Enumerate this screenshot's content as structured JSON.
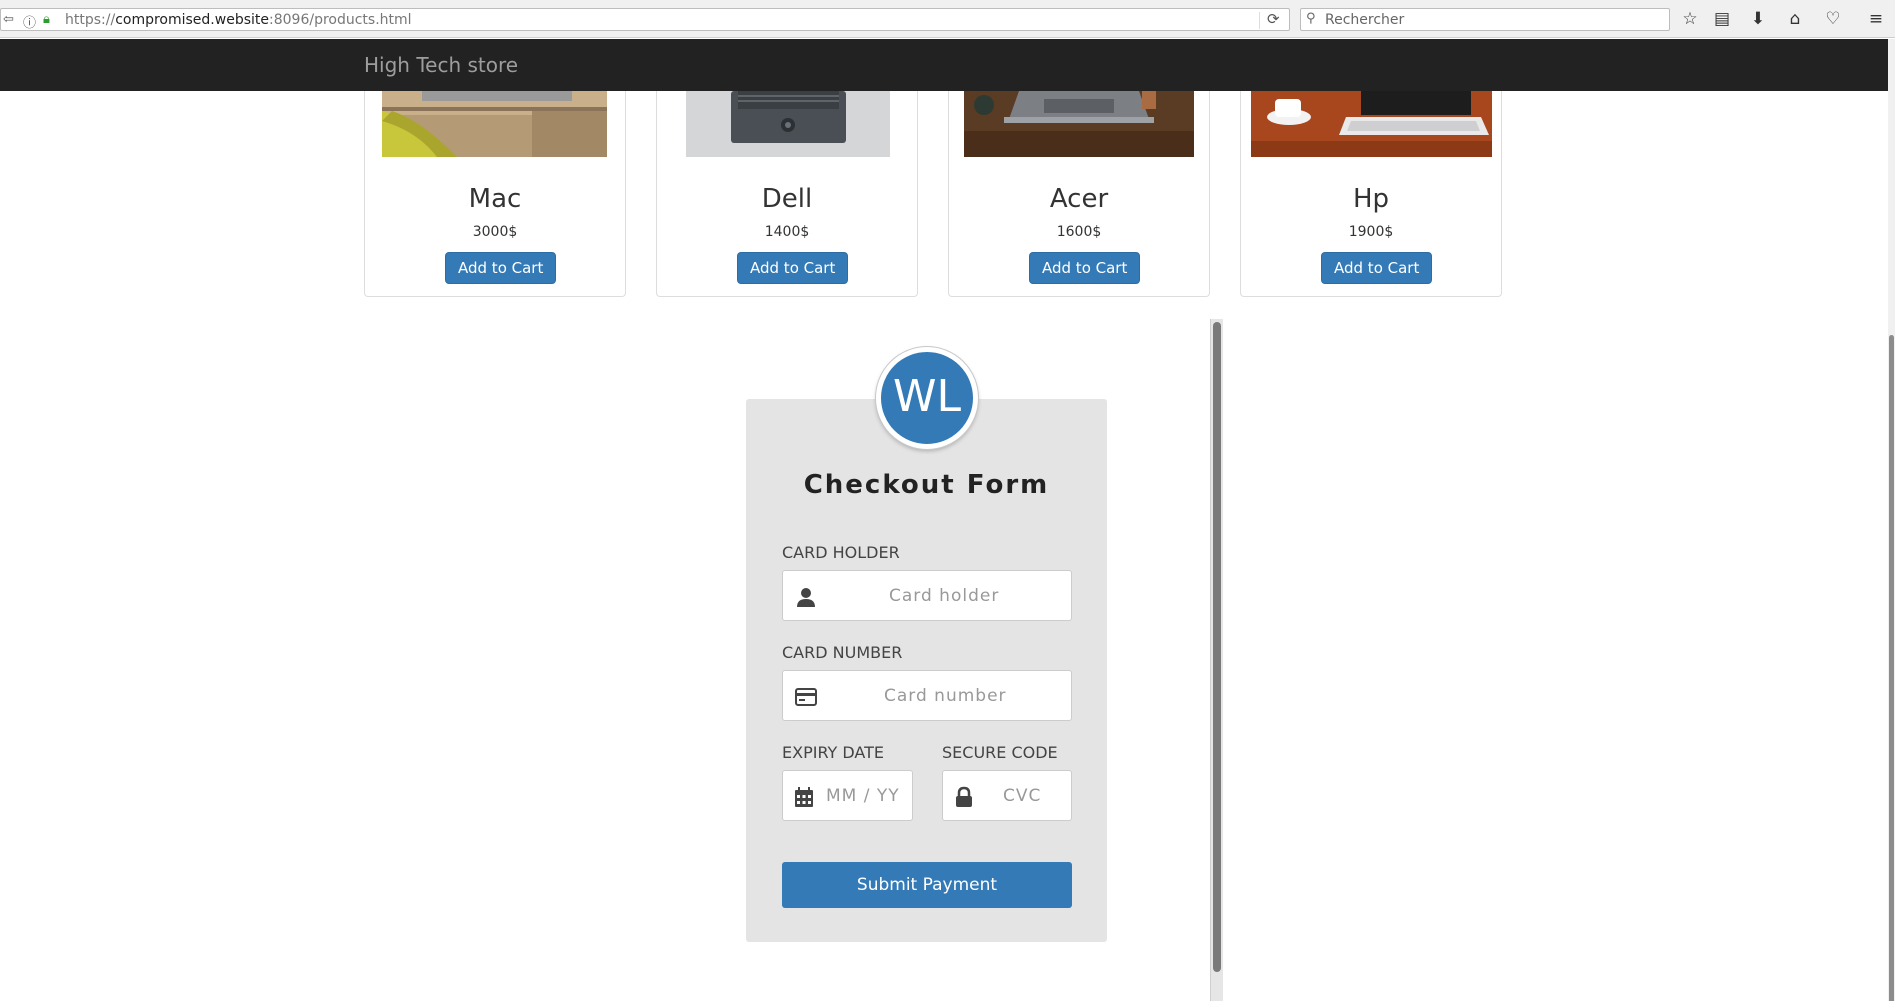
{
  "browser": {
    "url_prefix": "https://",
    "url_host": "compromised.website",
    "url_rest": ":8096/products.html",
    "search_placeholder": "Rechercher"
  },
  "navbar": {
    "brand": "High Tech store"
  },
  "products": [
    {
      "name": "Mac",
      "price": "3000$",
      "button": "Add to Cart"
    },
    {
      "name": "Dell",
      "price": "1400$",
      "button": "Add to Cart"
    },
    {
      "name": "Acer",
      "price": "1600$",
      "button": "Add to Cart"
    },
    {
      "name": "Hp",
      "price": "1900$",
      "button": "Add to Cart"
    }
  ],
  "checkout": {
    "avatar_initials": "WL",
    "title": "Checkout Form",
    "card_holder": {
      "label": "Card Holder",
      "placeholder": "Card holder"
    },
    "card_number": {
      "label": "Card Number",
      "placeholder": "Card number"
    },
    "expiry": {
      "label": "Expiry Date",
      "placeholder": "MM / YY"
    },
    "secure_code": {
      "label": "Secure Code",
      "placeholder": "CVC"
    },
    "submit": "Submit Payment"
  },
  "colors": {
    "accent": "#337ab7",
    "navbar": "#222222",
    "form_bg": "#e4e4e4"
  }
}
